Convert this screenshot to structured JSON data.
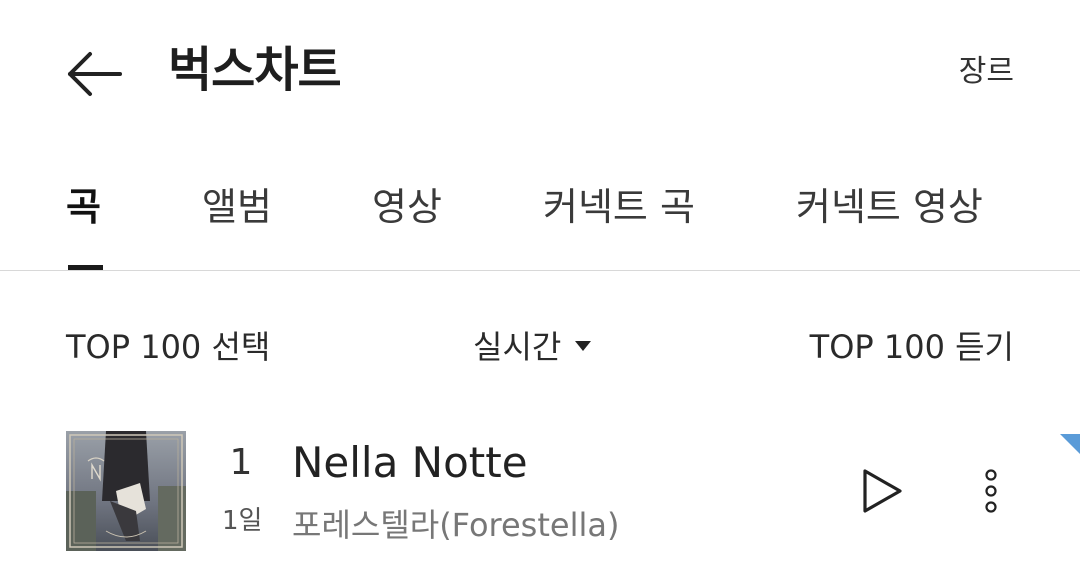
{
  "header": {
    "back_icon": "arrow-left-icon",
    "title": "벅스차트",
    "genre_label": "장르"
  },
  "tabs": [
    {
      "label": "곡",
      "active": true
    },
    {
      "label": "앨범",
      "active": false
    },
    {
      "label": "영상",
      "active": false
    },
    {
      "label": "커넥트 곡",
      "active": false
    },
    {
      "label": "커넥트 영상",
      "active": false
    }
  ],
  "controls": {
    "select_label": "TOP 100 선택",
    "period_label": "실시간",
    "listen_label": "TOP 100 듣기"
  },
  "songs": [
    {
      "rank": "1",
      "rank_change": "1일",
      "title": "Nella Notte",
      "artist": "포레스텔라(Forestella)",
      "play_icon": "play-icon",
      "more_icon": "more-vertical-icon"
    }
  ],
  "colors": {
    "accent": "#5a9bd8",
    "active_tab_underline": "#1a1a1a"
  }
}
